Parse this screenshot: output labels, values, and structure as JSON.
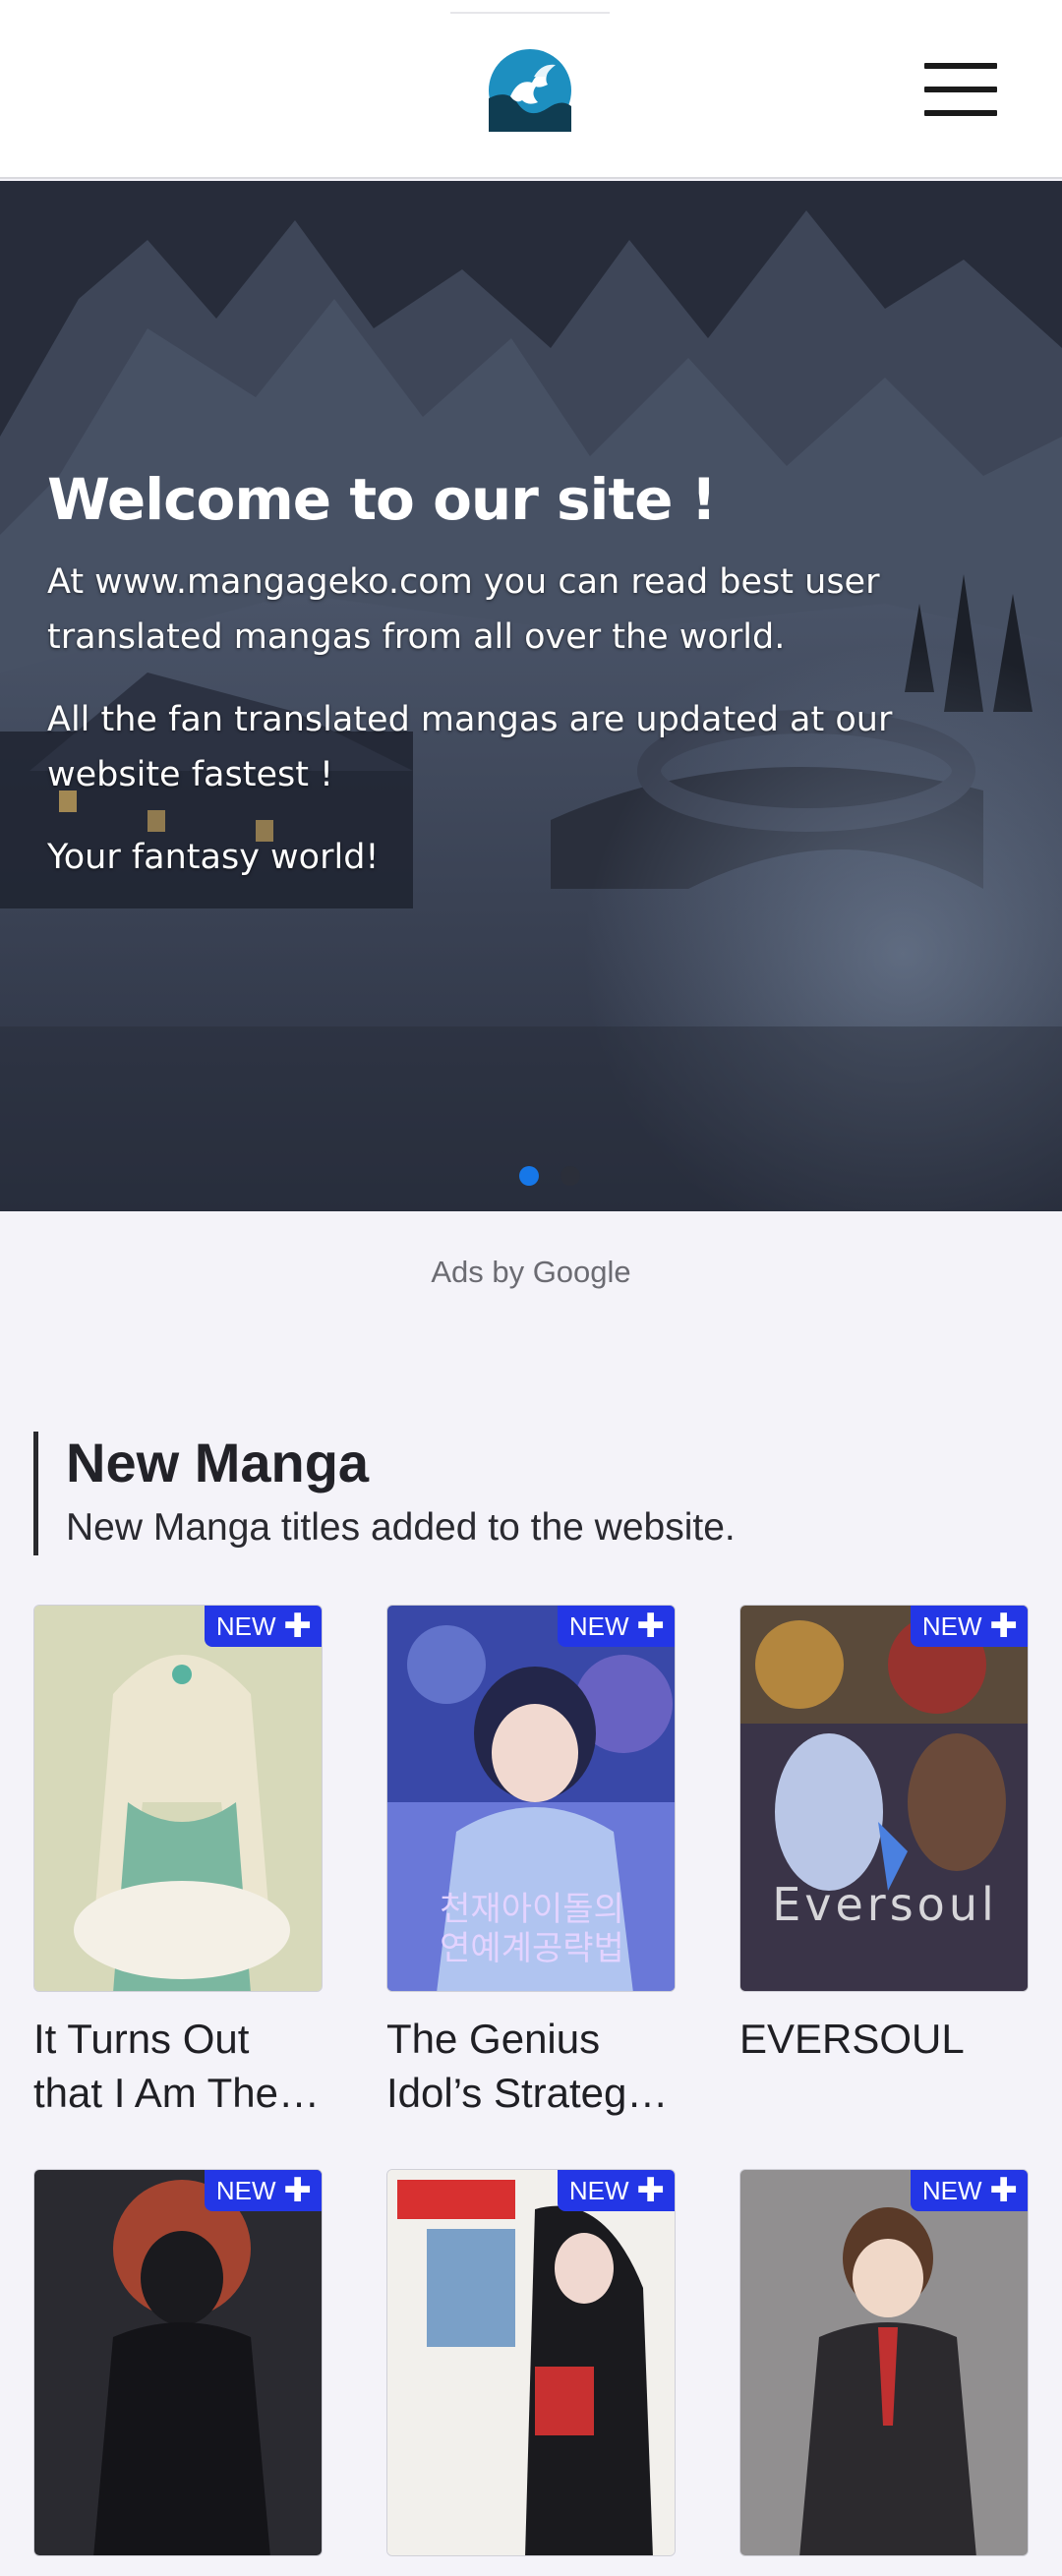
{
  "header": {
    "logo": "mangageko-logo-icon",
    "menu_icon": "hamburger-menu-icon"
  },
  "hero": {
    "title": "Welcome to our site !",
    "paragraphs": [
      "At www.mangageko.com you can read best user translated mangas from all over the world.",
      "All the fan translated mangas are updated at our website fastest !",
      "Your fantasy world!"
    ],
    "slide_count": 2,
    "active_slide": 1
  },
  "ads": {
    "label": "Ads by Google"
  },
  "section": {
    "title": "New Manga",
    "subtitle": "New Manga titles added to the website."
  },
  "badge": {
    "label": "NEW",
    "plus": "✚"
  },
  "manga": [
    {
      "title": "It Turns Out that I Am The Genius of a Wealthy Family"
    },
    {
      "title": "The Genius Idol’s Strategy Guide"
    },
    {
      "title": "EVERSOUL"
    },
    {
      "title": ""
    },
    {
      "title": ""
    },
    {
      "title": ""
    }
  ],
  "colors": {
    "accent_blue": "#1677e8",
    "badge_blue": "#2336e6",
    "page_bg": "#f4f3f9"
  }
}
